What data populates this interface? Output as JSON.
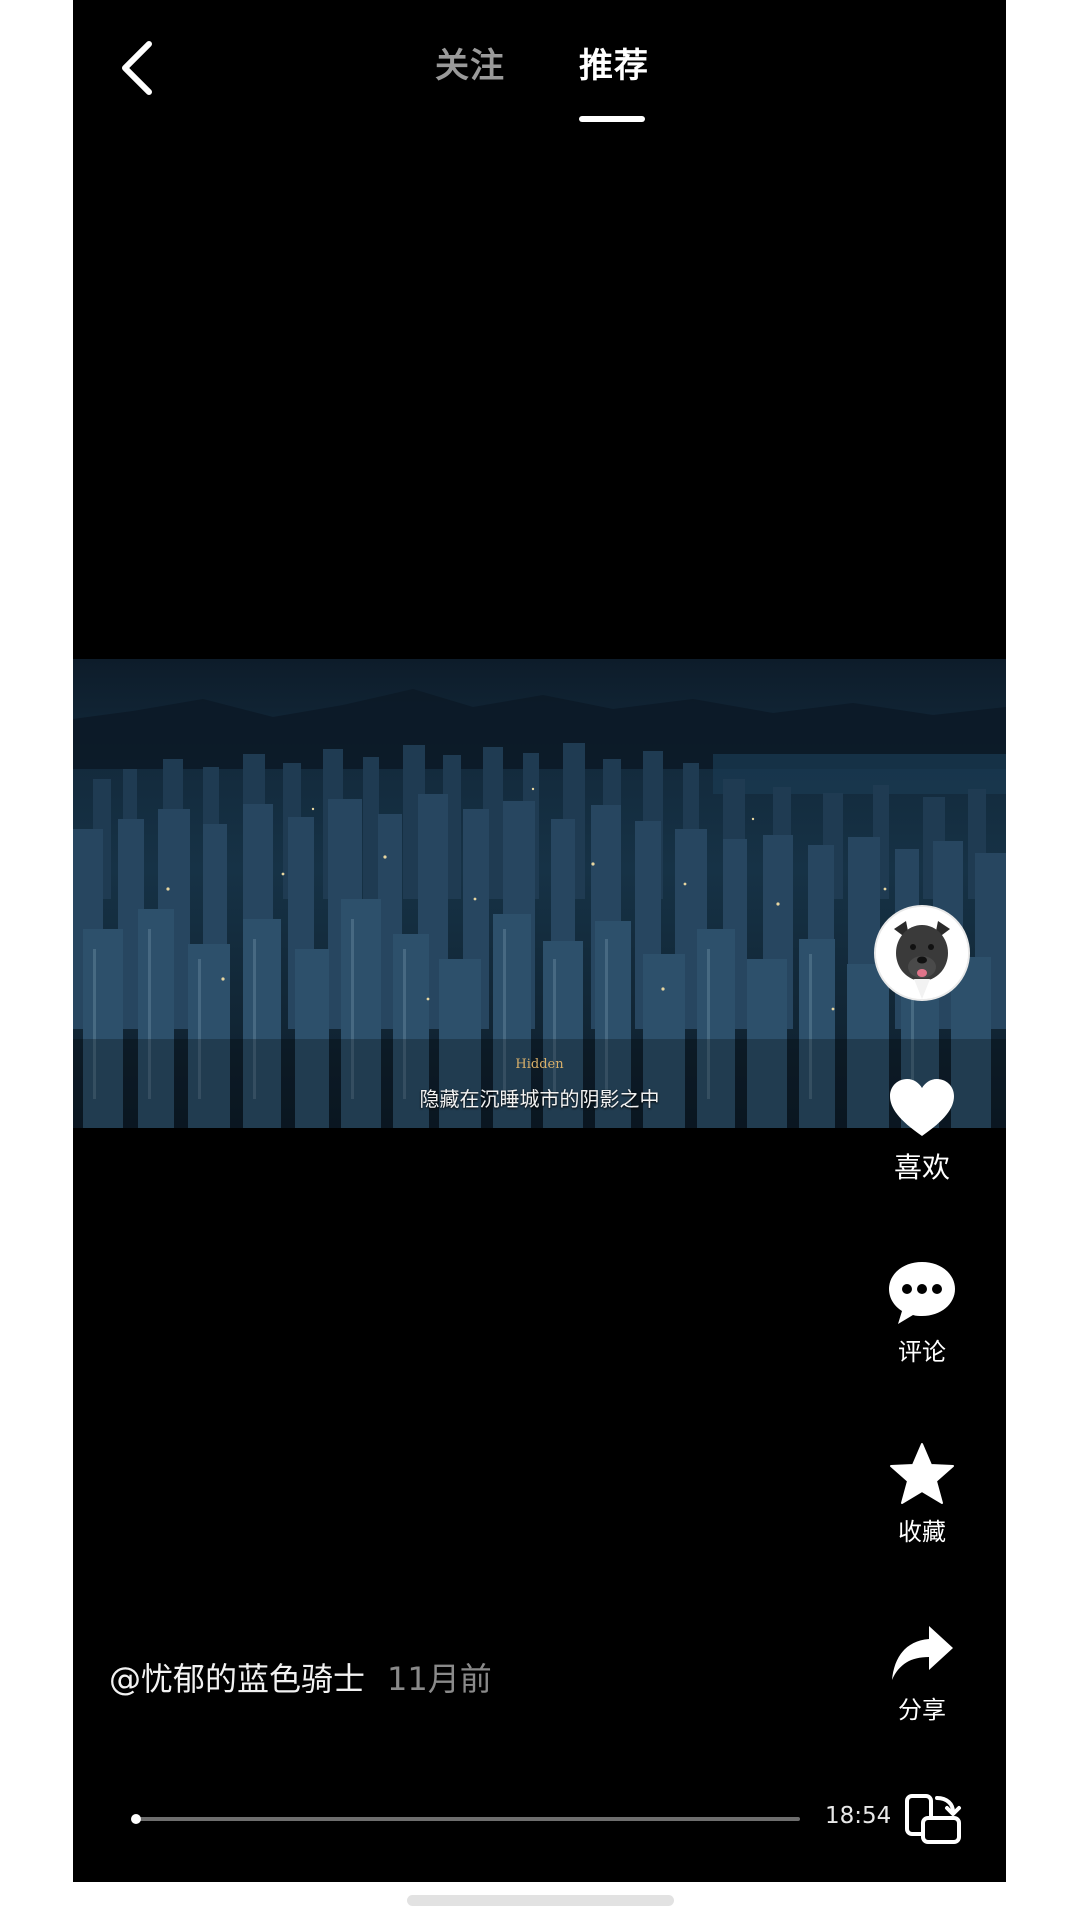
{
  "nav": {
    "back_icon": "chevron-left-icon",
    "tabs": [
      {
        "label": "关注",
        "active": false
      },
      {
        "label": "推荐",
        "active": true
      }
    ]
  },
  "video": {
    "subtitle_small": "Hidden",
    "subtitle": "隐藏在沉睡城市的阴影之中"
  },
  "actions": {
    "avatar": "dog-avatar",
    "like": {
      "label": "喜欢",
      "icon": "heart-icon"
    },
    "comment": {
      "label": "评论",
      "icon": "comment-bubble-icon"
    },
    "favorite": {
      "label": "收藏",
      "icon": "star-icon"
    },
    "share": {
      "label": "分享",
      "icon": "share-arrow-icon"
    }
  },
  "post": {
    "author": "@忧郁的蓝色骑士",
    "time_ago": "11月前"
  },
  "player": {
    "duration": "18:54",
    "progress": 0.0,
    "rotate_icon": "rotate-screen-icon"
  },
  "colors": {
    "background": "#000000",
    "inactive_tab": "#9a9a9a",
    "muted_text": "#8a8a8a",
    "subtitle_accent": "#d9b06a"
  }
}
